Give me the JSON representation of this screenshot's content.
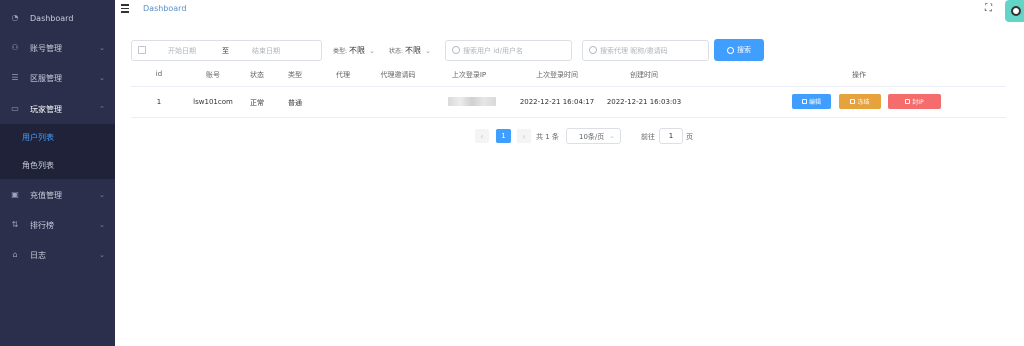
{
  "sidebar": {
    "items": [
      {
        "label": "Dashboard",
        "icon": "dashboard-icon"
      },
      {
        "label": "账号管理",
        "icon": "users-icon"
      },
      {
        "label": "区服管理",
        "icon": "server-icon"
      },
      {
        "label": "玩家管理",
        "icon": "gamepad-icon"
      },
      {
        "label": "充值管理",
        "icon": "wallet-icon"
      },
      {
        "label": "排行榜",
        "icon": "ranking-icon"
      },
      {
        "label": "日志",
        "icon": "log-icon"
      }
    ],
    "submenu": [
      {
        "label": "用户列表"
      },
      {
        "label": "角色列表"
      }
    ]
  },
  "header": {
    "breadcrumb": "Dashboard"
  },
  "filters": {
    "date_start_placeholder": "开始日期",
    "date_separator": "至",
    "date_end_placeholder": "结束日期",
    "type_label": "类型:",
    "type_value": "不限",
    "status_label": "状态:",
    "status_value": "不限",
    "search_user_placeholder": "搜索用户 id/用户名",
    "search_agent_placeholder": "搜索代理 昵称/邀请码",
    "search_button": "搜索"
  },
  "table": {
    "headers": [
      "id",
      "账号",
      "状态",
      "类型",
      "代理",
      "代理邀请码",
      "上次登录IP",
      "上次登录时间",
      "创建时间",
      "操作"
    ],
    "rows": [
      {
        "id": "1",
        "account": "lsw101com",
        "status": "正常",
        "type": "普通",
        "agent": "",
        "agent_code": "",
        "last_login_time": "2022-12-21 16:04:17",
        "created_time": "2022-12-21 16:03:03",
        "actions": {
          "edit": "编辑",
          "freeze": "冻结",
          "ban_ip": "封IP"
        }
      }
    ]
  },
  "pagination": {
    "prev": "‹",
    "current": "1",
    "next": "›",
    "total": "共 1 条",
    "page_size": "10条/页",
    "goto_label": "前往",
    "goto_value": "1",
    "page_suffix": "页"
  },
  "colors": {
    "sidebar_bg": "#2b2f4b",
    "submenu_bg": "#1f2238",
    "primary": "#409eff",
    "warning": "#e6a23c",
    "danger": "#f56c6c"
  }
}
